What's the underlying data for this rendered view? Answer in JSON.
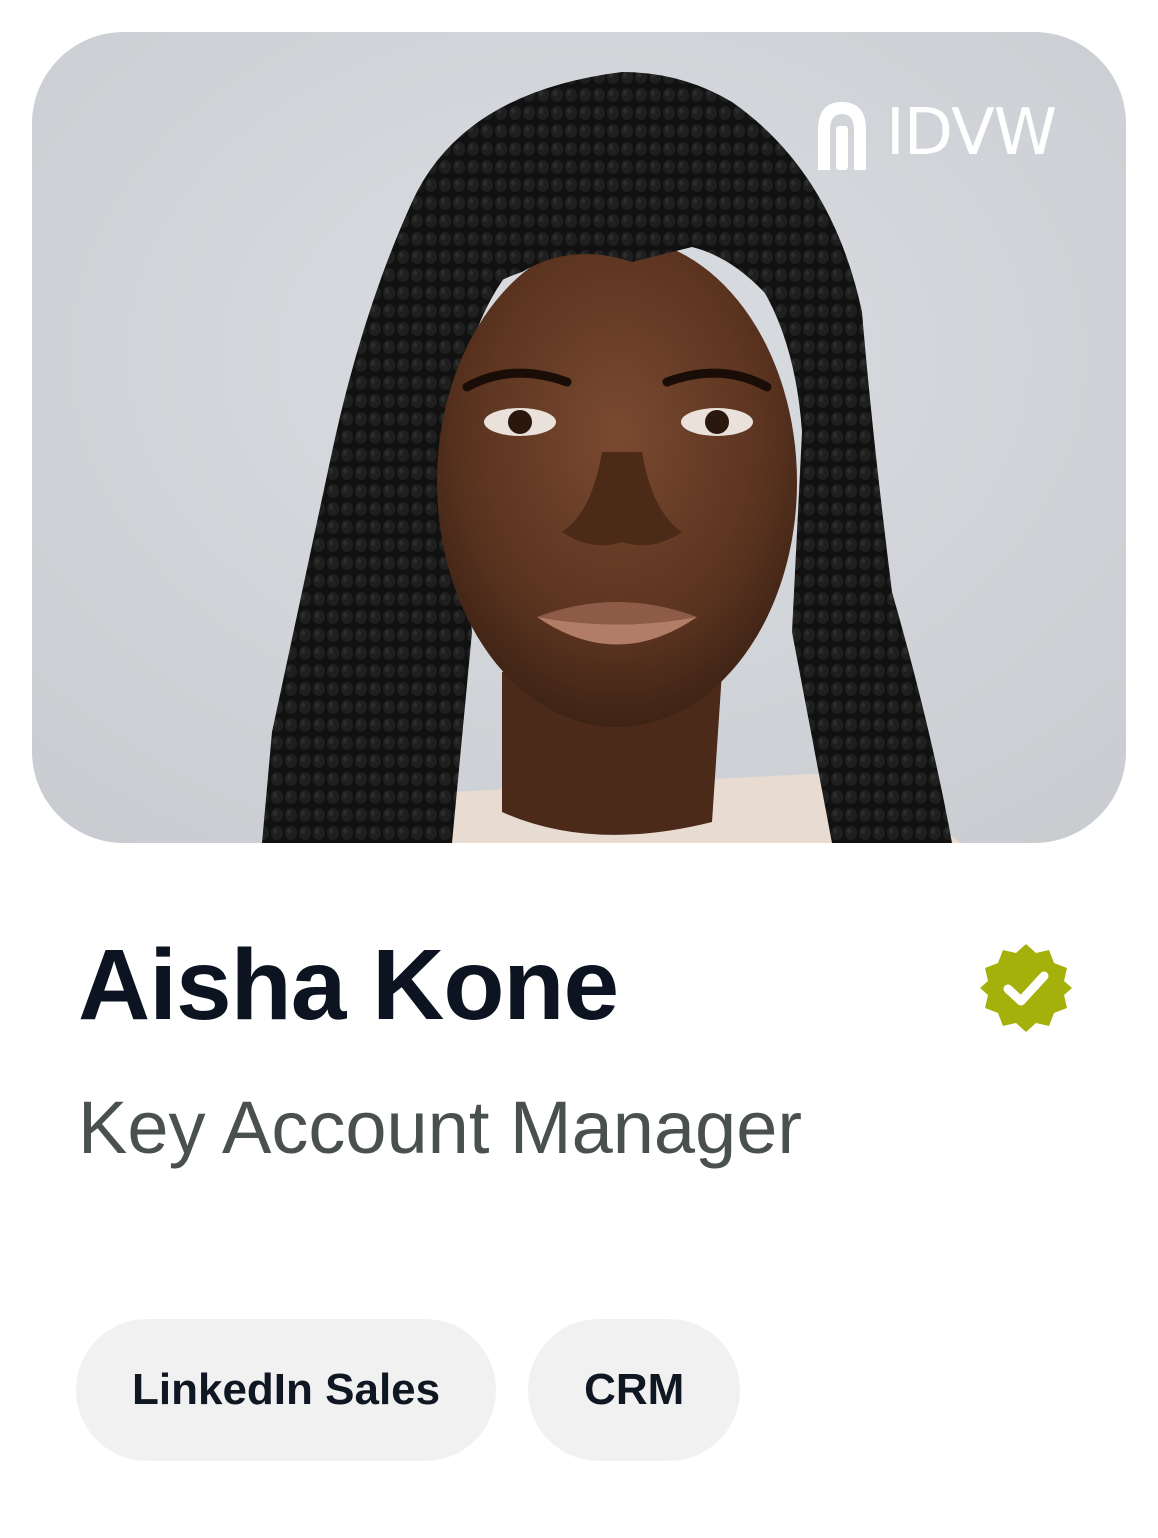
{
  "brand": {
    "logo_text": "IDVW",
    "logo_icon": "idvw-logo-icon"
  },
  "profile": {
    "name": "Aisha Kone",
    "role": "Key Account Manager",
    "verified_icon": "verified-badge-icon",
    "verified_color": "#a3b10a"
  },
  "tags": [
    {
      "label": "LinkedIn Sales"
    },
    {
      "label": "CRM"
    }
  ],
  "colors": {
    "name_text": "#0b1420",
    "role_text": "#4a5050",
    "tag_bg": "#f1f1f1",
    "photo_bg": "#d2d5d9"
  }
}
